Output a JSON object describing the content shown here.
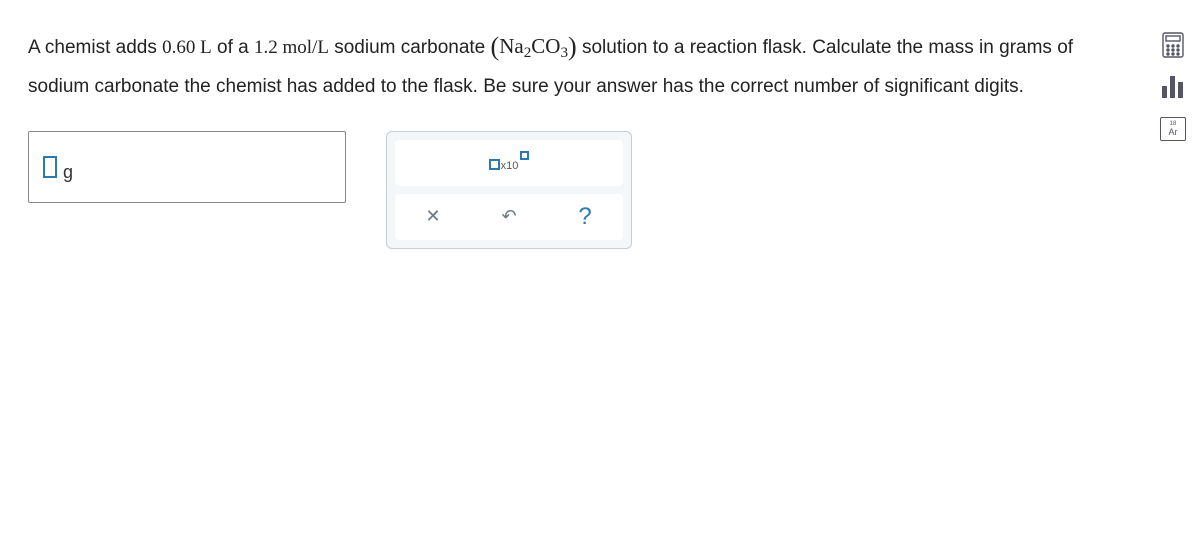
{
  "question": {
    "p1a": "A chemist adds ",
    "vol": "0.60 L",
    "p1b": " of a ",
    "conc": "1.2 mol/L",
    "p1c": " sodium carbonate ",
    "formula_na": "Na",
    "formula_sub1": "2",
    "formula_co": "CO",
    "formula_sub2": "3",
    "p1d": " solution to a reaction flask. Calculate the mass in grams of sodium carbonate the chemist has added to the flask. Be sure your answer has the correct number of significant digits."
  },
  "answer": {
    "unit": "g"
  },
  "tools": {
    "sci_label": "x10",
    "clear": "✕",
    "reset": "↶",
    "help": "?"
  },
  "side": {
    "pt_num": "18",
    "pt_sym": "Ar"
  }
}
